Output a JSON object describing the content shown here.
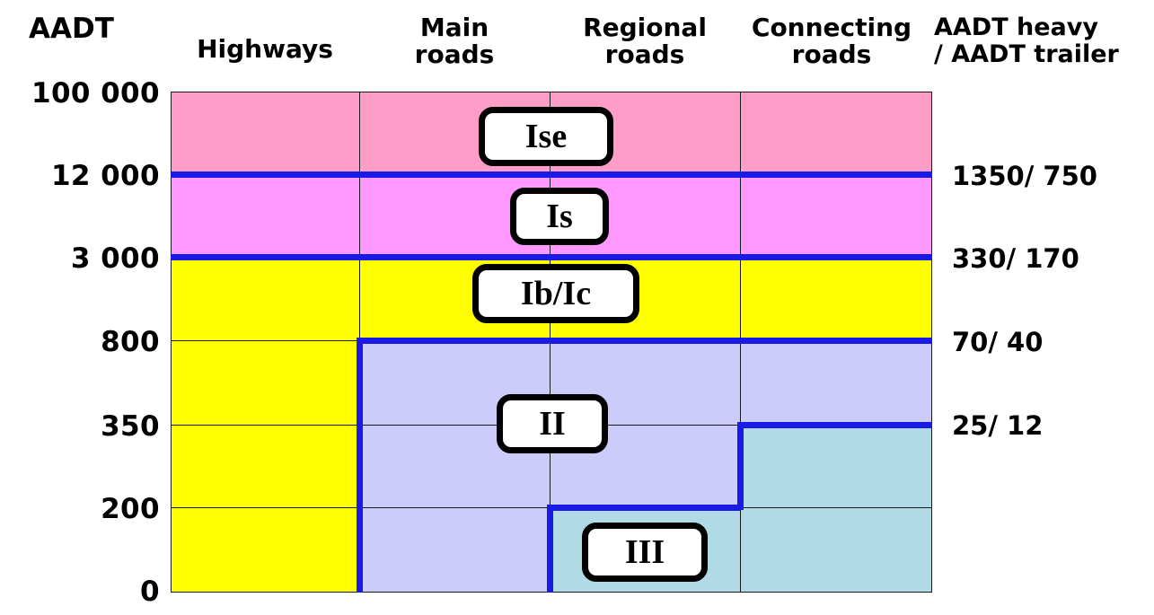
{
  "axis": {
    "y_title": "AADT",
    "right_title_line1": "AADT heavy",
    "right_title_line2": "/ AADT trailer"
  },
  "columns": [
    {
      "id": "highways",
      "label_line1": "Highways",
      "label_line2": ""
    },
    {
      "id": "main",
      "label_line1": "Main",
      "label_line2": "roads"
    },
    {
      "id": "regional",
      "label_line1": "Regional",
      "label_line2": "roads"
    },
    {
      "id": "connecting",
      "label_line1": "Connecting",
      "label_line2": "roads"
    }
  ],
  "y_ticks": [
    "100 000",
    "12 000",
    "3 000",
    "800",
    "350",
    "200",
    "0"
  ],
  "right_labels": [
    "1350/ 750",
    "330/ 170",
    "70/ 40",
    "25/ 12"
  ],
  "classes": [
    {
      "id": "ise",
      "label": "Ise"
    },
    {
      "id": "is",
      "label": "Is"
    },
    {
      "id": "ibic",
      "label": "Ib/Ic"
    },
    {
      "id": "ii",
      "label": "II"
    },
    {
      "id": "iii",
      "label": "III"
    }
  ],
  "colors": {
    "pink": "#FF9DC9",
    "magenta": "#FF99FF",
    "yellow": "#FFFF00",
    "lavender": "#CCCCFA",
    "cyan": "#B0DAE6",
    "boundary_blue": "#1A1AE6",
    "grid": "#1A1A1A"
  },
  "chart_data": {
    "type": "heatmap",
    "title": "",
    "xlabel": "",
    "ylabel": "AADT",
    "categories": [
      "Highways",
      "Main roads",
      "Regional roads",
      "Connecting roads"
    ],
    "y_tick_labels": [
      "100 000",
      "12 000",
      "3 000",
      "800",
      "350",
      "200",
      "0"
    ],
    "y_tick_values": [
      100000,
      12000,
      3000,
      800,
      350,
      200,
      0
    ],
    "right_axis_label": "AADT heavy / AADT trailer",
    "right_tick_labels": [
      "1350/ 750",
      "330/ 170",
      "70/ 40",
      "25/ 12"
    ],
    "right_tick_at_y": [
      "12 000",
      "3 000",
      "800",
      "350"
    ],
    "grid": true,
    "legend": "none",
    "annotations": [
      "Ise",
      "Is",
      "Ib/Ic",
      "II",
      "III"
    ],
    "bands": [
      {
        "class": "Ise",
        "aadt_range": [
          "12 000",
          "100 000"
        ],
        "aadt_heavy_trailer": "1350/ 750",
        "columns": [
          "Highways",
          "Main roads",
          "Regional roads",
          "Connecting roads"
        ],
        "color": "#FF9DC9"
      },
      {
        "class": "Is",
        "aadt_range": [
          "3 000",
          "12 000"
        ],
        "aadt_heavy_trailer": "330/ 170",
        "columns": [
          "Highways",
          "Main roads",
          "Regional roads",
          "Connecting roads"
        ],
        "color": "#FF99FF"
      },
      {
        "class": "Ib/Ic",
        "aadt_range": [
          "800",
          "3 000"
        ],
        "aadt_heavy_trailer": "70/ 40",
        "columns": [
          "Highways",
          "Main roads",
          "Regional roads",
          "Connecting roads"
        ],
        "color": "#FFFF00"
      },
      {
        "class": "II",
        "aadt_range": [
          "200",
          "800"
        ],
        "aadt_heavy_trailer": "25/ 12",
        "columns": [
          "Main roads",
          "Regional roads",
          "Connecting roads"
        ],
        "color": "#CCCCFA"
      },
      {
        "class": "III",
        "aadt_range": [
          "0",
          "350"
        ],
        "aadt_heavy_trailer": "",
        "columns": [
          "Regional roads",
          "Connecting roads"
        ],
        "color": "#B0DAE6"
      }
    ],
    "notes": [
      "Highways column stays yellow (class Ib/Ic) for all AADT below 3 000.",
      "Class II lower boundary steps: Main roads down to 0, Regional roads down to 200, Connecting roads down to 350.",
      "Class III occupies Regional roads below 200 and Connecting roads below 350."
    ]
  }
}
